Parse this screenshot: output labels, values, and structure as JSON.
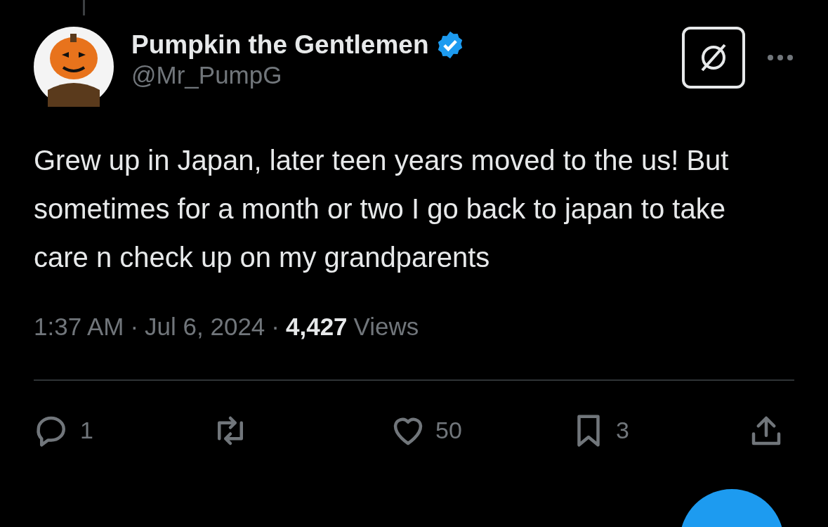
{
  "author": {
    "name": "Pumpkin the Gentlemen",
    "handle": "@Mr_PumpG",
    "verified": true
  },
  "text": "Grew up in Japan, later teen years moved to the us! But sometimes for a month or two I go back to japan to take care n check up on my grandparents",
  "meta": {
    "time": "1:37 AM",
    "separator_1": "·",
    "date": "Jul 6, 2024",
    "separator_2": "·",
    "views_count": "4,427",
    "views_label": "Views"
  },
  "actions": [
    {
      "kind": "reply",
      "count": "1"
    },
    {
      "kind": "repost"
    },
    {
      "kind": "like",
      "count": "50"
    },
    {
      "kind": "bookmark",
      "count": "3"
    },
    {
      "kind": "share"
    }
  ]
}
